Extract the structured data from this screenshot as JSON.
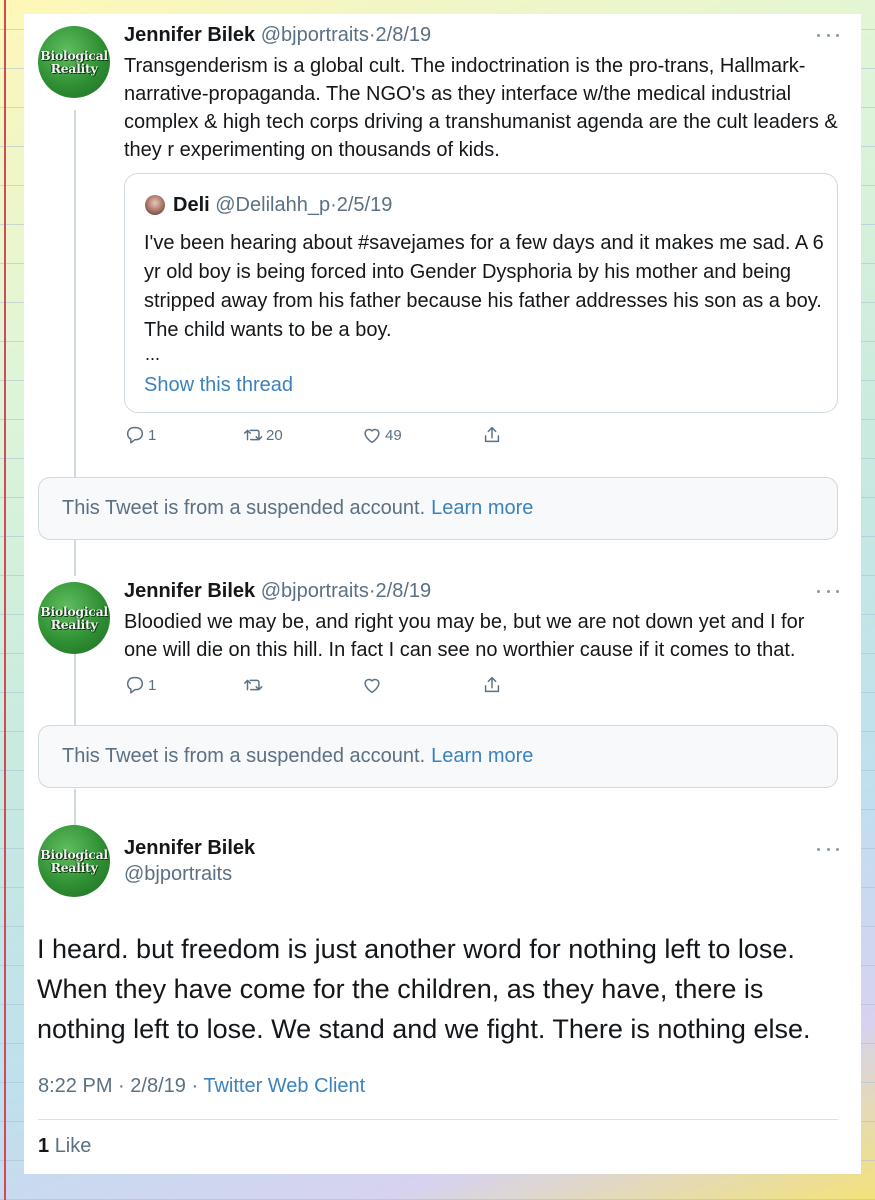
{
  "tweets": [
    {
      "avatar_text": [
        "Biological",
        "Reality"
      ],
      "name": "Jennifer Bilek",
      "handle": "@bjportraits",
      "sep": "·",
      "date": "2/8/19",
      "text": "Transgenderism is a global cult.  The indoctrination is the pro-trans, Hallmark-narrative-propaganda.  The NGO's as they interface w/the medical industrial complex & high tech corps driving a transhumanist agenda are the cult leaders & they r experimenting on thousands of kids.",
      "quote": {
        "name": "Deli",
        "handle": "@Delilahh_p",
        "sep": "·",
        "date": "2/5/19",
        "text": "I've been hearing about #savejames for a few days and it makes me sad. A 6 yr old boy is being forced into Gender Dysphoria by his mother and being stripped away from his father because his father addresses his son as a boy. The child wants to be a boy.",
        "ellipsis": "...",
        "show_thread": "Show this thread"
      },
      "replies": "1",
      "retweets": "20",
      "likes": "49"
    },
    {
      "avatar_text": [
        "Biological",
        "Reality"
      ],
      "name": "Jennifer Bilek",
      "handle": "@bjportraits",
      "sep": "·",
      "date": "2/8/19",
      "text": "Bloodied we may be, and right you may be, but we are not down yet and I for one will die on this hill.  In fact I can see no worthier cause if it comes to that.",
      "replies": "1",
      "retweets": "",
      "likes": ""
    }
  ],
  "suspended": {
    "text": "This Tweet is from a suspended account.",
    "link": "Learn more"
  },
  "main_tweet": {
    "avatar_text": [
      "Biological",
      "Reality"
    ],
    "name": "Jennifer Bilek",
    "handle": "@bjportraits",
    "text": "I heard.  but freedom is just another word for nothing left to lose.  When they have come for the children, as they have, there is nothing left to lose.  We stand and we fight.  There is nothing else.",
    "time": "8:22 PM",
    "sep": "·",
    "date": "2/8/19",
    "client": "Twitter Web Client",
    "like_count": "1",
    "like_label": "Like"
  },
  "icons": {
    "reply": "reply-icon",
    "retweet": "retweet-icon",
    "like": "heart-icon",
    "share": "share-icon",
    "more": "more-icon"
  },
  "colors": {
    "link": "#3b82bd",
    "muted": "#5b7083",
    "avatar_green": "#2f8f33"
  }
}
